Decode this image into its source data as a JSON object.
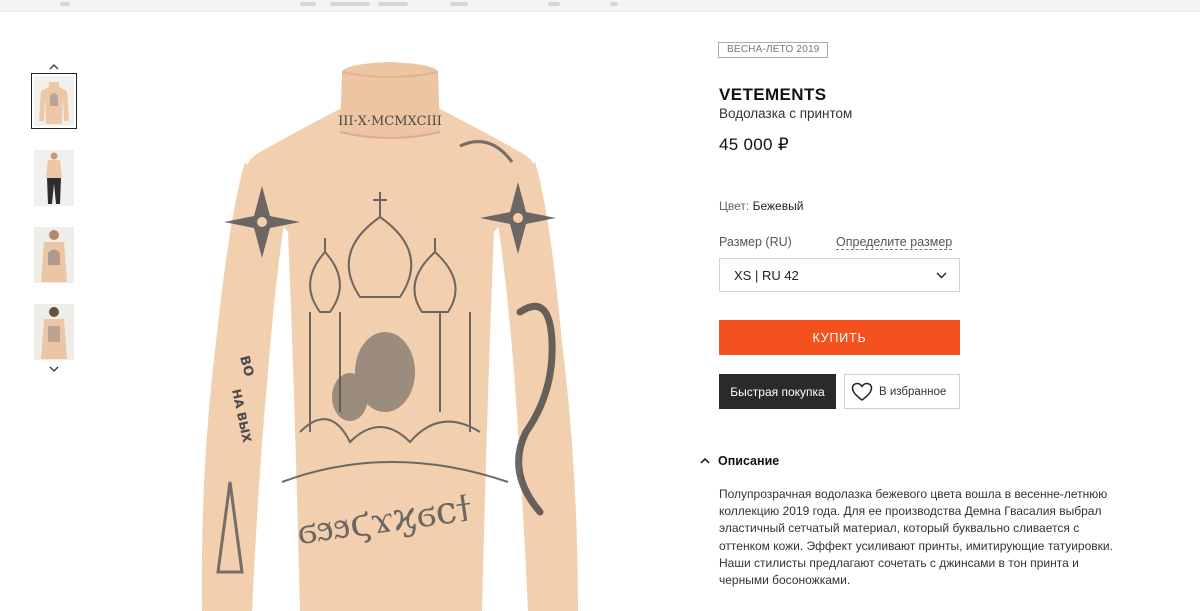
{
  "gallery": {
    "thumbnails": [
      {
        "label": "Водолазка — вид спереди"
      },
      {
        "label": "Водолазка — образ целиком"
      },
      {
        "label": "Водолазка — на модели"
      },
      {
        "label": "Водолазка — вид сзади"
      }
    ],
    "print_text": {
      "collar": "III·X·MCMXCIII",
      "belly": "ϭϧϧϛϫϗϭϲϯ",
      "sleeve_top": "ВО",
      "sleeve_bottom": "НА ВЫХ"
    }
  },
  "product": {
    "season": "ВЕСНА-ЛЕТО 2019",
    "brand": "VETEMENTS",
    "name": "Водолазка с принтом",
    "price": "45 000 ₽",
    "color_label": "Цвет:",
    "color_value": "Бежевый",
    "size_label": "Размер (RU)",
    "size_guide": "Определите размер",
    "size_selected": "XS | RU 42",
    "buy_label": "КУПИТЬ",
    "quick_buy_label": "Быстрая покупка",
    "favorite_label": "В избранное"
  },
  "description": {
    "title": "Описание",
    "lines": [
      "Полупрозрачная водолазка бежевого цвета вошла в весенне-летнюю",
      "коллекцию 2019 года. Для ее производства Демна Гвасалия выбрал",
      "эластичный сетчатый материал, который буквально сливается с",
      "оттенком кожи. Эффект усиливают принты, имитирующие татуировки.",
      "Наши стилисты предлагают сочетать с джинсами в тон принта и",
      "черными босоножками."
    ]
  },
  "colors": {
    "accent": "#f4511e",
    "dark_button": "#2a2a2a",
    "garment": "#f2cfae",
    "ink": "#4a4a4a"
  },
  "icons": {
    "thumb_up": "chevron-up-icon",
    "thumb_down": "chevron-down-icon",
    "select": "chevron-down-icon",
    "favorite": "heart-icon",
    "description": "chevron-up-icon"
  }
}
